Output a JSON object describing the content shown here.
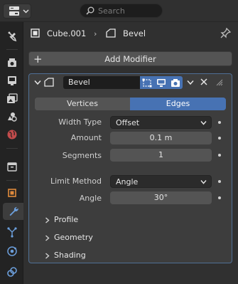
{
  "header": {
    "search_placeholder": "Search"
  },
  "breadcrumb": {
    "object": "Cube.001",
    "separator": "›",
    "modifier": "Bevel"
  },
  "add_modifier_label": "Add Modifier",
  "modifier": {
    "name": "Bevel",
    "affect_options": [
      "Vertices",
      "Edges"
    ],
    "affect_selected": "Edges",
    "width_type": {
      "label": "Width Type",
      "value": "Offset"
    },
    "amount": {
      "label": "Amount",
      "value": "0.1 m"
    },
    "segments": {
      "label": "Segments",
      "value": "1"
    },
    "limit_method": {
      "label": "Limit Method",
      "value": "Angle"
    },
    "angle": {
      "label": "Angle",
      "value": "30°"
    },
    "subpanels": [
      "Profile",
      "Geometry",
      "Shading"
    ]
  },
  "tabs": [
    "tool",
    "render",
    "output",
    "view-layer",
    "scene",
    "world",
    "collection",
    "object",
    "modifiers",
    "particles",
    "physics",
    "constraints"
  ],
  "colors": {
    "accent": "#4772b3",
    "panel_border": "#4f6f95",
    "background": "#303030"
  }
}
